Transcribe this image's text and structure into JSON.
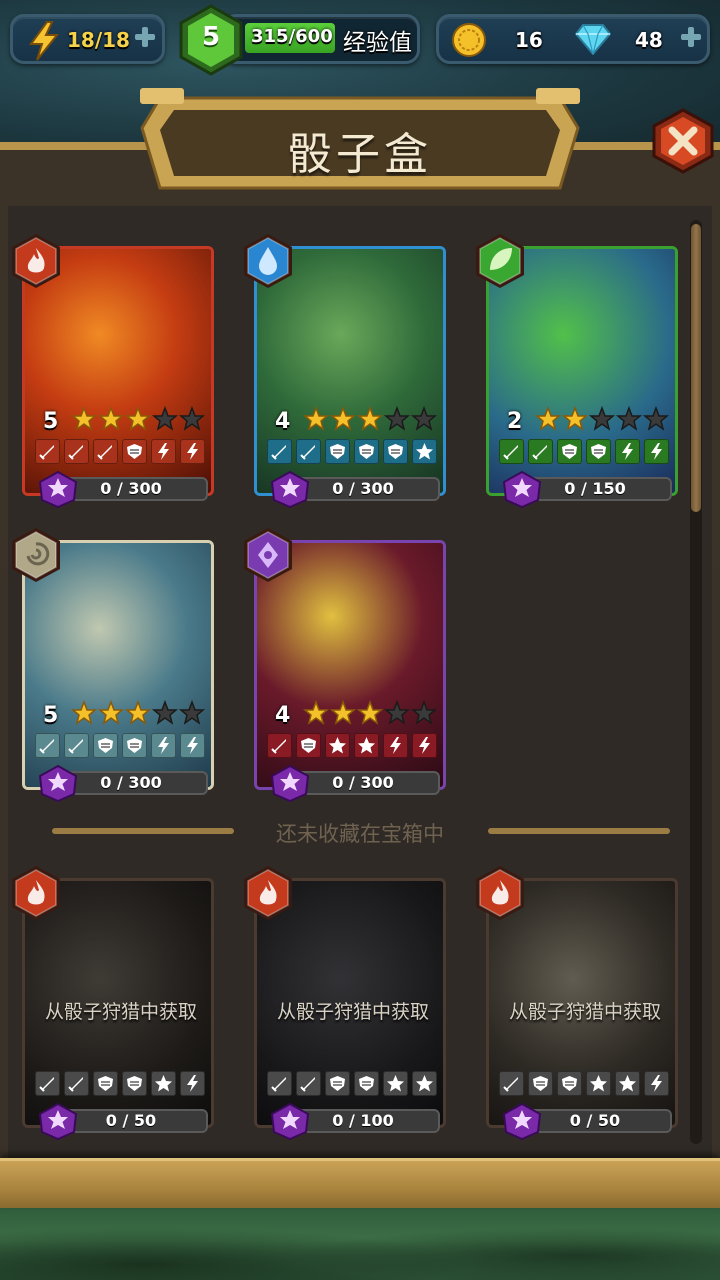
{
  "top_bar": {
    "energy": "18/18",
    "level": "5",
    "xp": "315/600",
    "xp_label": "经验值",
    "xp_fraction": 0.525,
    "coins": "16",
    "gems": "48"
  },
  "title": "骰子盒",
  "divider_label": "还未收藏在宝箱中",
  "colors": {
    "fire": "#c63a25",
    "water": "#2f8fd0",
    "nature": "#3aa030",
    "air": "#d8d0b0",
    "arcane": "#7a44b0"
  },
  "owned_cards": [
    {
      "element": "fire-icon",
      "level": "5",
      "stars": 3,
      "progress": "0 / 300",
      "faces": [
        "sword",
        "sword",
        "sword",
        "shield",
        "bolt",
        "bolt"
      ]
    },
    {
      "element": "water-drop-icon",
      "level": "4",
      "stars": 3,
      "progress": "0 / 300",
      "faces": [
        "sword",
        "sword",
        "shield",
        "shield",
        "shield",
        "star"
      ]
    },
    {
      "element": "leaf-icon",
      "level": "2",
      "stars": 2,
      "progress": "0 / 150",
      "faces": [
        "sword",
        "sword",
        "shield",
        "shield",
        "bolt",
        "bolt"
      ]
    },
    {
      "element": "wind-swirl-icon",
      "level": "5",
      "stars": 3,
      "progress": "0 / 300",
      "faces": [
        "sword",
        "sword",
        "shield",
        "shield",
        "bolt",
        "bolt"
      ]
    },
    {
      "element": "arcane-icon",
      "level": "4",
      "stars": 3,
      "progress": "0 / 300",
      "faces": [
        "sword",
        "shield",
        "star",
        "star",
        "bolt",
        "bolt"
      ]
    }
  ],
  "locked_cards": [
    {
      "obtain": "从骰子狩猎中获取",
      "progress": "0 / 50",
      "faces": [
        "sword",
        "sword",
        "shield",
        "shield",
        "star",
        "bolt"
      ]
    },
    {
      "obtain": "从骰子狩猎中获取",
      "progress": "0 / 100",
      "faces": [
        "sword",
        "sword",
        "shield",
        "shield",
        "star",
        "star"
      ]
    },
    {
      "obtain": "从骰子狩猎中获取",
      "progress": "0 / 50",
      "faces": [
        "sword",
        "shield",
        "shield",
        "star",
        "star",
        "bolt"
      ]
    }
  ]
}
